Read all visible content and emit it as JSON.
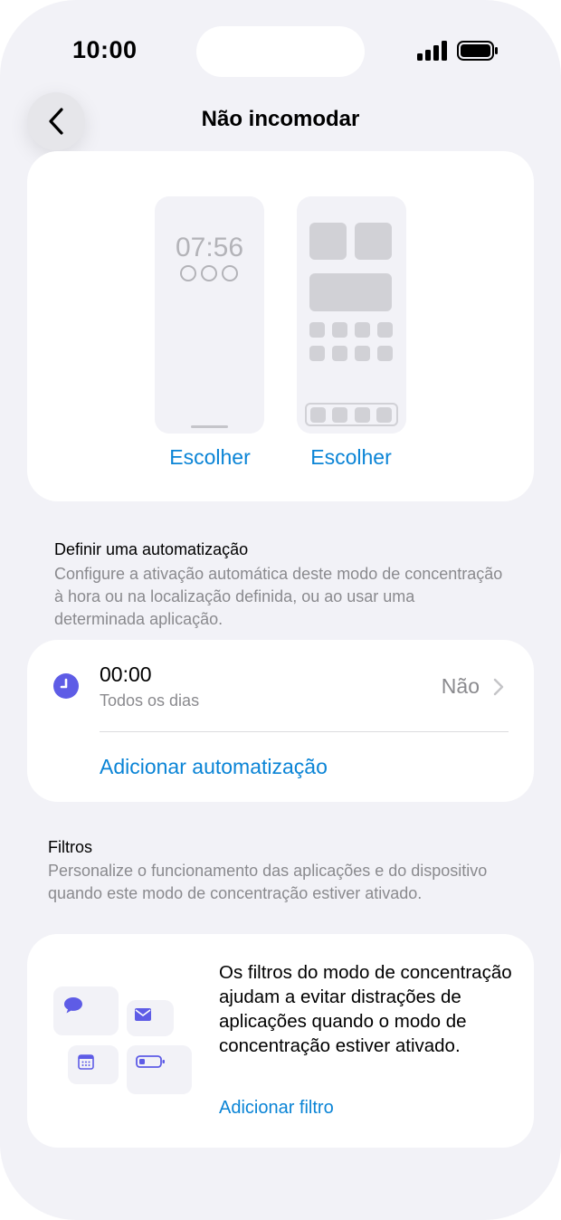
{
  "status_bar": {
    "time": "10:00"
  },
  "nav": {
    "title": "Não incomodar"
  },
  "customize": {
    "lock_time": "07:56",
    "choose_lock": "Escolher",
    "choose_home": "Escolher"
  },
  "automation": {
    "title": "Definir uma automatização",
    "description": "Configure a ativação automática deste modo de concentração à hora ou na localização definida, ou ao usar uma determinada aplicação.",
    "item_time": "00:00",
    "item_days": "Todos os dias",
    "item_status": "Não",
    "add_label": "Adicionar automatização"
  },
  "filters": {
    "title": "Filtros",
    "description": "Personalize o funcionamento das aplicações e do dispositivo quando este modo de concentração estiver ativado.",
    "info": "Os filtros do modo de concentração ajudam a evitar distrações de aplicações quando o modo de concentração estiver ativado.",
    "add_label": "Adicionar filtro"
  },
  "colors": {
    "accent": "#0a84d6",
    "icon_purple": "#5e5ce6",
    "secondary_text": "#8a8a8e",
    "background": "#f2f2f7"
  },
  "icons": [
    "signal-icon",
    "battery-icon",
    "back-chevron-icon",
    "clock-icon",
    "chevron-right-icon",
    "message-icon",
    "mail-icon",
    "calendar-icon",
    "battery-small-icon"
  ]
}
